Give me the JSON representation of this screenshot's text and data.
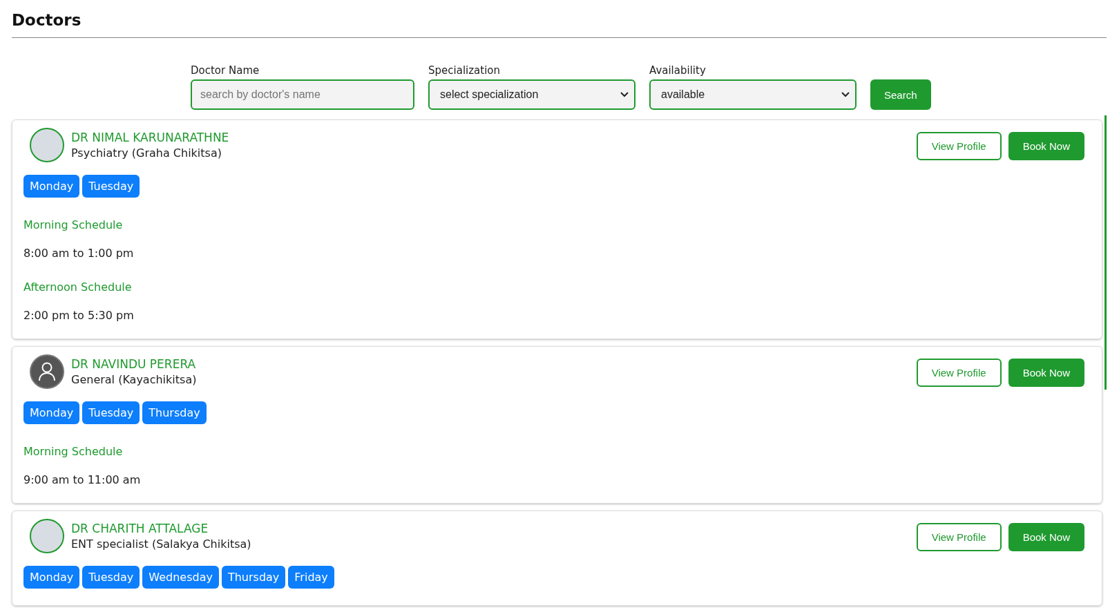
{
  "page": {
    "title": "Doctors"
  },
  "filters": {
    "doctor_name": {
      "label": "Doctor Name",
      "placeholder": "search by doctor's name"
    },
    "specialization": {
      "label": "Specialization",
      "value": "select specialization"
    },
    "availability": {
      "label": "Availability",
      "value": "available"
    },
    "search_button": "Search"
  },
  "doctors": [
    {
      "name": "DR NIMAL KARUNARATHNE",
      "specialization": "Psychiatry (Graha Chikitsa)",
      "kind": "photo",
      "days": [
        "Monday",
        "Tuesday"
      ],
      "schedules": [
        {
          "label": "Morning Schedule",
          "time": "8:00 am to 1:00 pm"
        },
        {
          "label": "Afternoon Schedule",
          "time": "2:00 pm to 5:30 pm"
        }
      ],
      "view_button": "View Profile",
      "book_button": "Book Now"
    },
    {
      "name": "DR NAVINDU PERERA",
      "specialization": "General (Kayachikitsa)",
      "kind": "default",
      "days": [
        "Monday",
        "Tuesday",
        "Thursday"
      ],
      "schedules": [
        {
          "label": "Morning Schedule",
          "time": "9:00 am to 11:00 am"
        }
      ],
      "view_button": "View Profile",
      "book_button": "Book Now"
    },
    {
      "name": "DR CHARITH ATTALAGE",
      "specialization": "ENT specialist (Salakya Chikitsa)",
      "kind": "photo",
      "days": [
        "Monday",
        "Tuesday",
        "Wednesday",
        "Thursday",
        "Friday"
      ],
      "view_button": "View Profile",
      "book_button": "Book Now"
    }
  ]
}
